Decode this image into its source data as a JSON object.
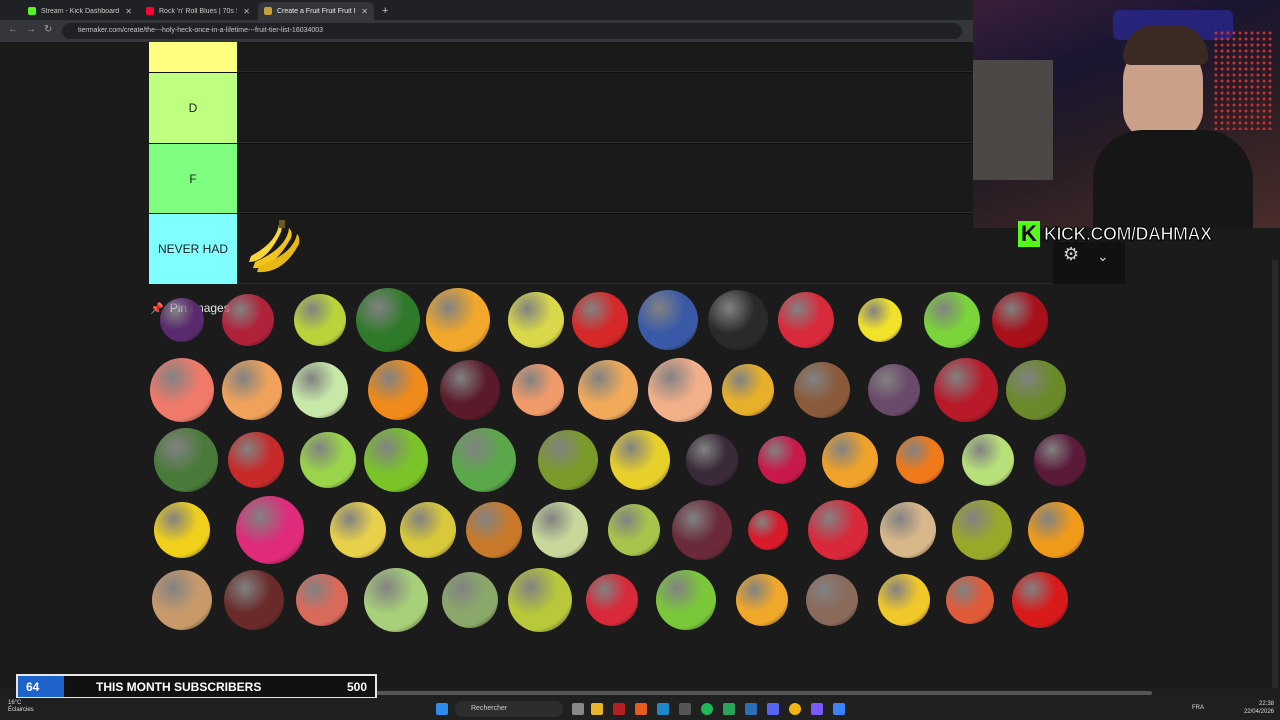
{
  "browser": {
    "tabs": [
      {
        "title": "Stream - Kick Dashboard",
        "favicon_color": "#53fc18"
      },
      {
        "title": "Rock 'n' Roll Blues | 70s Swing...",
        "favicon_color": "#ff0033"
      },
      {
        "title": "Create a Fruit Fruit Fruit Fr...",
        "favicon_color": "#c8a03a"
      }
    ],
    "new_tab": "+",
    "url": "tiermaker.com/create/the---holy-heck-once-in-a-lifetime---fruit-tier-list-16034003"
  },
  "tiers": [
    {
      "label": "",
      "color": "#ffff7f"
    },
    {
      "label": "D",
      "color": "#bfff7f"
    },
    {
      "label": "F",
      "color": "#7fff7f"
    },
    {
      "label": "NEVER HAD",
      "color": "#7fffff"
    }
  ],
  "pin_images": {
    "title": "Pin Images",
    "icon": "pushpin-icon"
  },
  "overlay": {
    "kick_logo": "K",
    "channel": "KICK.COM/DAHMAX",
    "sub_goal": {
      "count": "64",
      "label": "THIS MONTH SUBSCRIBERS",
      "goal": "500",
      "progress": 0.128
    }
  },
  "taskbar": {
    "search_placeholder": "Rechercher",
    "weather_temp": "16°C",
    "weather_text": "Éclaircies",
    "lang": "FRA",
    "time": "22:38",
    "date": "22/04/2026"
  }
}
